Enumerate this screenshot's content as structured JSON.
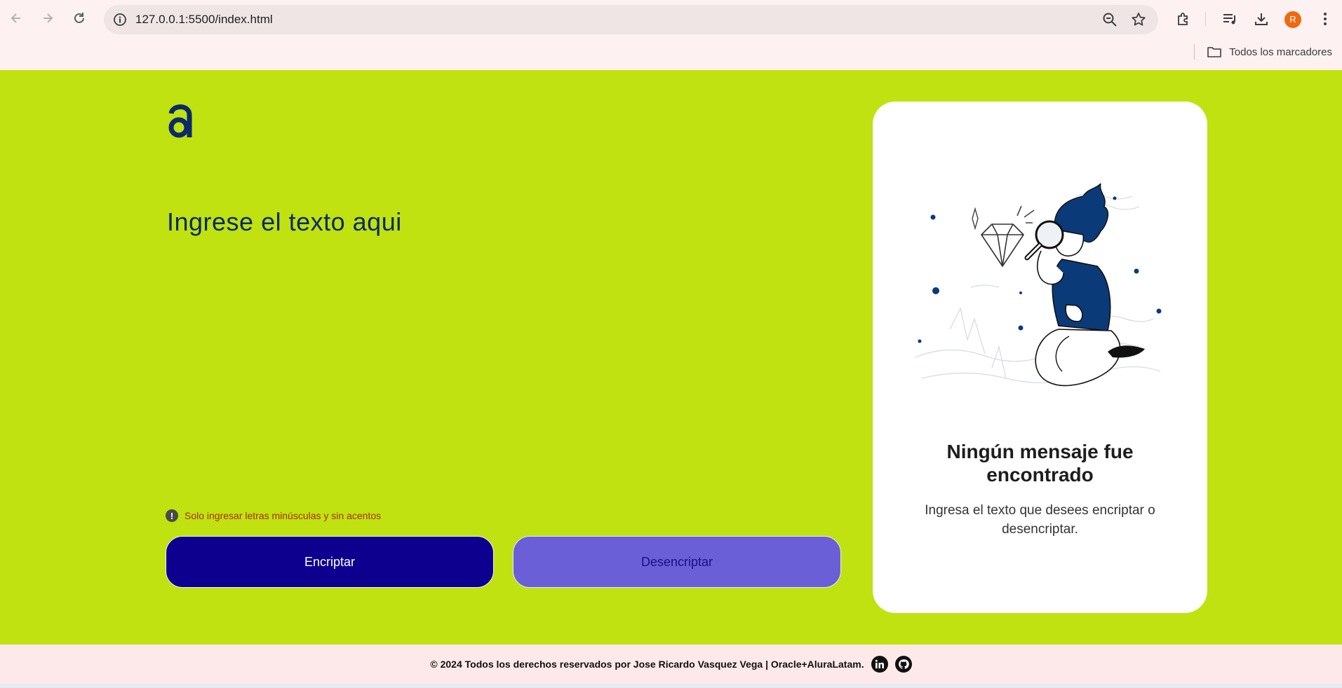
{
  "browser": {
    "url": "127.0.0.1:5500/index.html",
    "bookmarks_label": "Todos los marcadores",
    "avatar_letter": "R",
    "avatar_color": "#ee6a10"
  },
  "app": {
    "logo_icon": "alura-a-logo",
    "prompt": "Ingrese el texto aqui",
    "warning": "Solo ingresar letras minúsculas y sin acentos",
    "encrypt_label": "Encriptar",
    "decrypt_label": "Desencriptar",
    "colors": {
      "background": "#bfe210",
      "primary": "#0e008f",
      "secondary": "#6a5fd6",
      "text": "#0b2a6b"
    }
  },
  "result_panel": {
    "title": "Ningún mensaje fue encontrado",
    "subtitle": "Ingresa el texto que desees encriptar o desencriptar."
  },
  "footer": {
    "text": "© 2024 Todos los derechos reservados por Jose Ricardo Vasquez Vega | Oracle+AluraLatam.",
    "icons": [
      "linkedin-icon",
      "github-icon"
    ]
  }
}
